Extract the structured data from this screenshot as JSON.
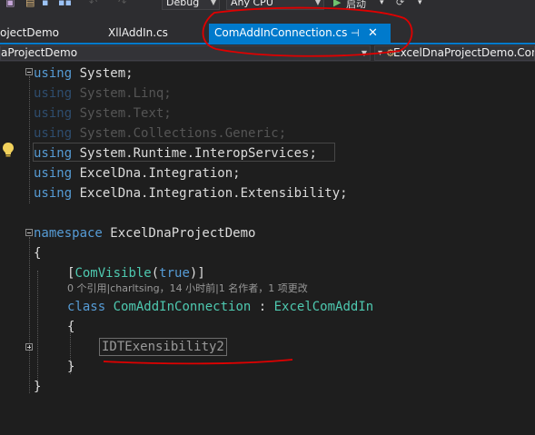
{
  "toolbar": {
    "config": "Debug",
    "platform": "Any CPU",
    "start_label": "启动"
  },
  "tabs": [
    {
      "label": "ojectDemo"
    },
    {
      "label": "XllAddIn.cs"
    },
    {
      "label": "ComAddInConnection.cs",
      "active": true
    }
  ],
  "navbar": {
    "project": "aProjectDemo",
    "class_path": "ExcelDnaProjectDemo.Com"
  },
  "code": {
    "l1": {
      "kw": "using",
      "rest": " System;"
    },
    "l2": {
      "kw": "using",
      "rest": " System.Linq;"
    },
    "l3": {
      "kw": "using",
      "rest": " System.Text;"
    },
    "l4": {
      "kw": "using",
      "rest": " System.Collections.Generic;"
    },
    "l5": {
      "kw": "using",
      "rest": " System.Runtime.InteropServices;"
    },
    "l6": {
      "kw": "using",
      "rest": " ExcelDna.Integration;"
    },
    "l7": {
      "kw": "using",
      "rest": " ExcelDna.Integration.Extensibility;"
    },
    "ns": {
      "kw": "namespace",
      "rest": " ExcelDnaProjectDemo"
    },
    "open_brace": "{",
    "attr": {
      "open": "[",
      "name": "ComVisible",
      "paren_open": "(",
      "value": "true",
      "close": ")]"
    },
    "codelens": "0 个引用|charltsing，14 小时前|1 名作者，1 项更改",
    "cls": {
      "kw": "class",
      "name": " ComAddInConnection",
      "colon": " : ",
      "base": "ExcelComAddIn"
    },
    "cls_open": "{",
    "collapsed": "IDTExensibility2",
    "cls_close": "}",
    "ns_close": "}"
  },
  "colors": {
    "accent": "#007acc",
    "keyword": "#569cd6",
    "type": "#4ec9b0",
    "annotation": "#e00000"
  }
}
